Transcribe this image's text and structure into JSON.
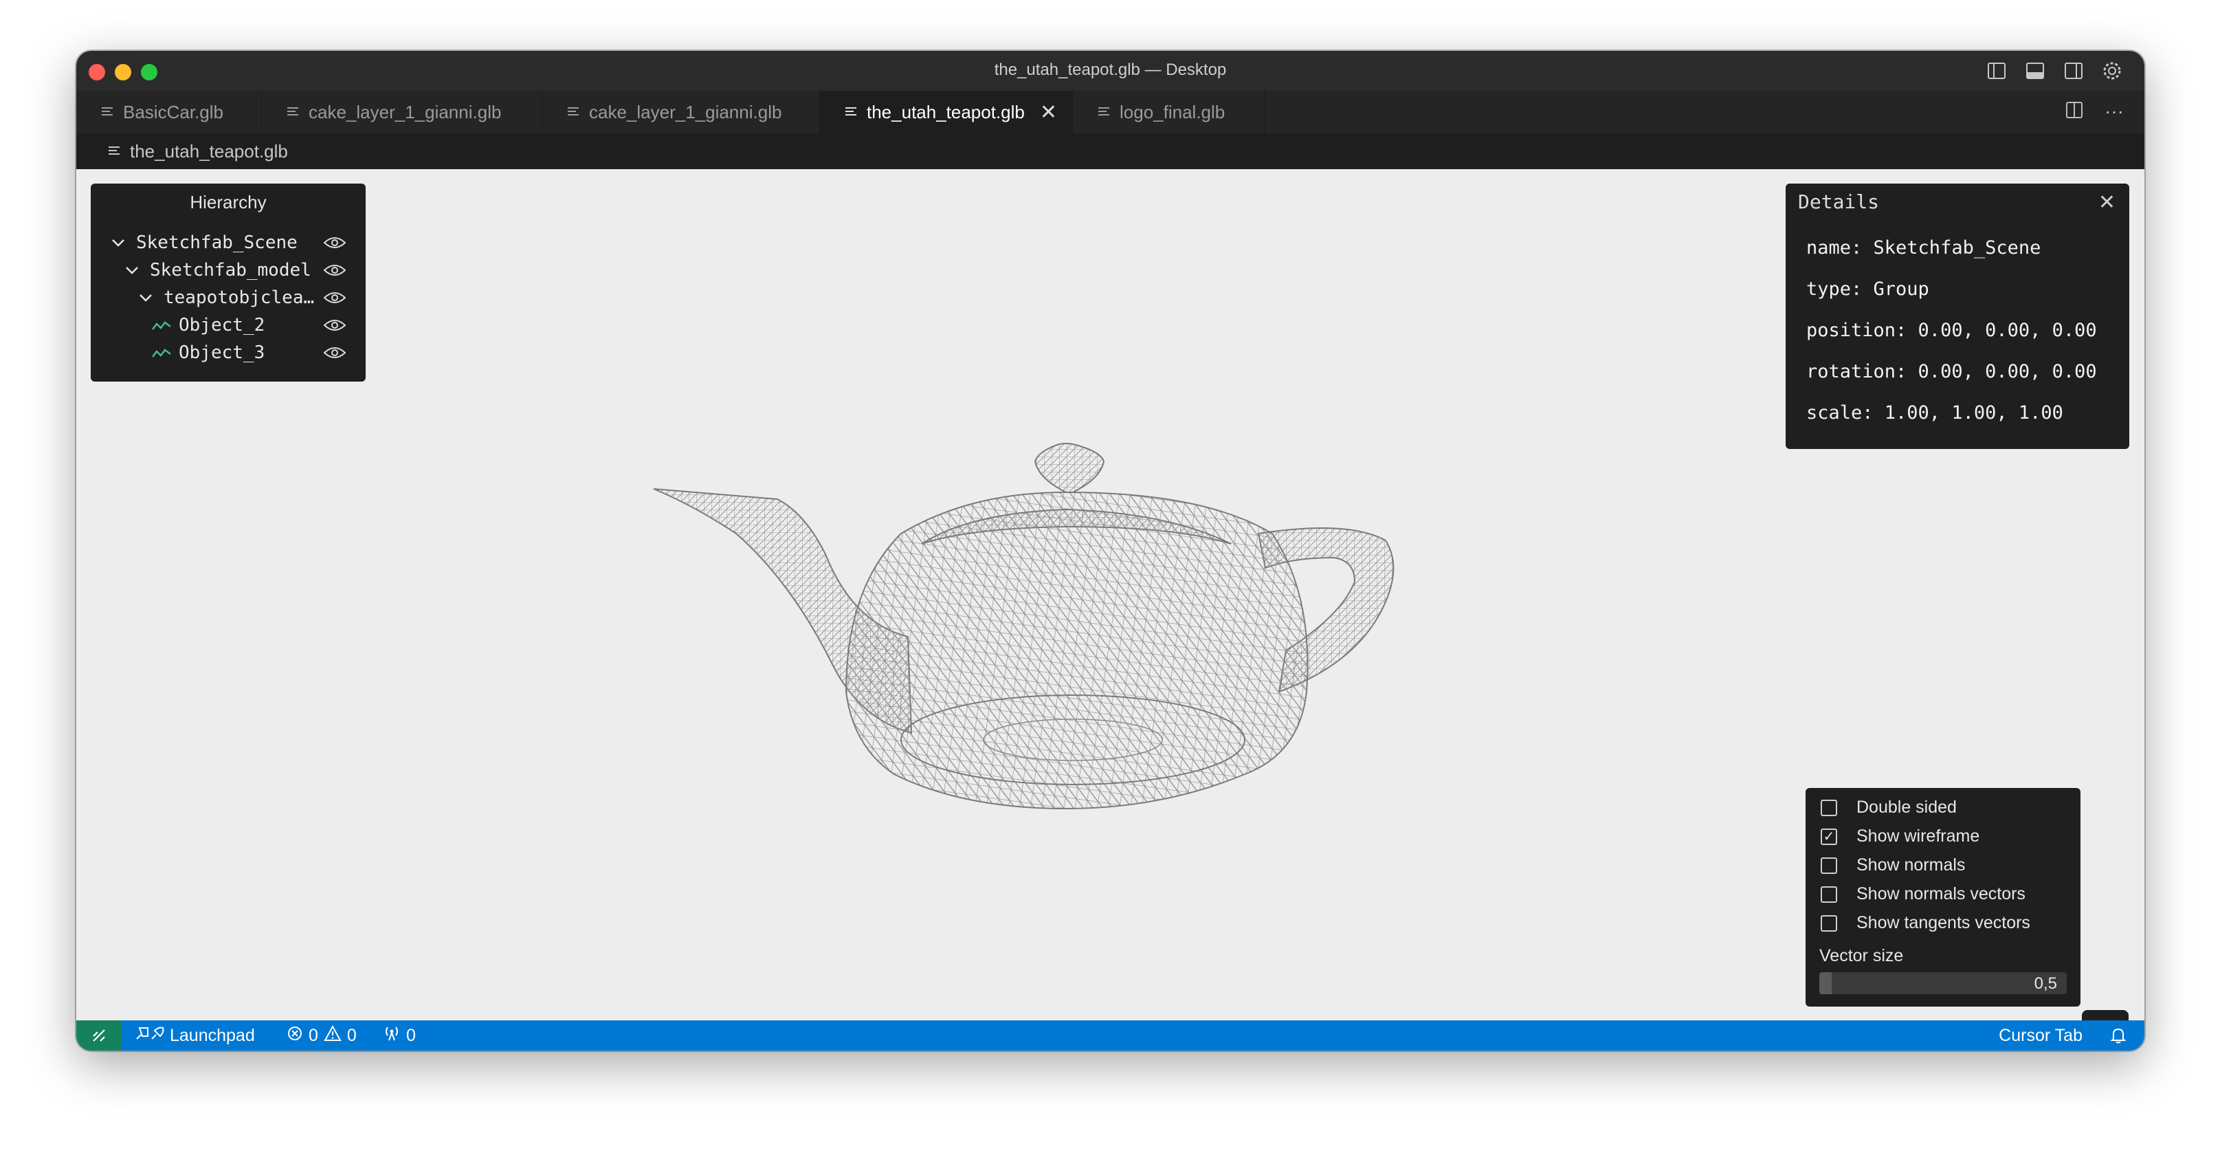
{
  "window": {
    "title": "the_utah_teapot.glb — Desktop"
  },
  "tabs": [
    {
      "label": "BasicCar.glb",
      "active": false
    },
    {
      "label": "cake_layer_1_gianni.glb",
      "active": false
    },
    {
      "label": "cake_layer_1_gianni.glb",
      "active": false
    },
    {
      "label": "the_utah_teapot.glb",
      "active": true
    },
    {
      "label": "logo_final.glb",
      "active": false
    }
  ],
  "breadcrumb": {
    "label": "the_utah_teapot.glb"
  },
  "hierarchy": {
    "title": "Hierarchy",
    "items": [
      {
        "label": "Sketchfab_Scene",
        "type": "group"
      },
      {
        "label": "Sketchfab_model",
        "type": "group"
      },
      {
        "label": "teapotobjclea…",
        "type": "group"
      },
      {
        "label": "Object_2",
        "type": "mesh"
      },
      {
        "label": "Object_3",
        "type": "mesh"
      }
    ]
  },
  "details": {
    "title": "Details",
    "rows": [
      "name: Sketchfab_Scene",
      "type: Group",
      "position: 0.00, 0.00, 0.00",
      "rotation: 0.00, 0.00, 0.00",
      "scale: 1.00, 1.00, 1.00"
    ]
  },
  "options": {
    "items": [
      {
        "label": "Double sided",
        "checked": false
      },
      {
        "label": "Show wireframe",
        "checked": true
      },
      {
        "label": "Show normals",
        "checked": false
      },
      {
        "label": "Show normals vectors",
        "checked": false
      },
      {
        "label": "Show tangents vectors",
        "checked": false
      }
    ],
    "vector_size_label": "Vector size",
    "vector_size_value": "0,5",
    "vector_size_fraction": 0.05
  },
  "statusbar": {
    "launchpad": "Launchpad",
    "errors": "0",
    "warnings": "0",
    "ports": "0",
    "cursor_tab": "Cursor Tab"
  },
  "colors": {
    "statusbar": "#0078d4",
    "remote": "#16825d",
    "panel": "#1f1f1f",
    "viewport": "#ededed",
    "mesh_icon": "#3fbf8f"
  }
}
